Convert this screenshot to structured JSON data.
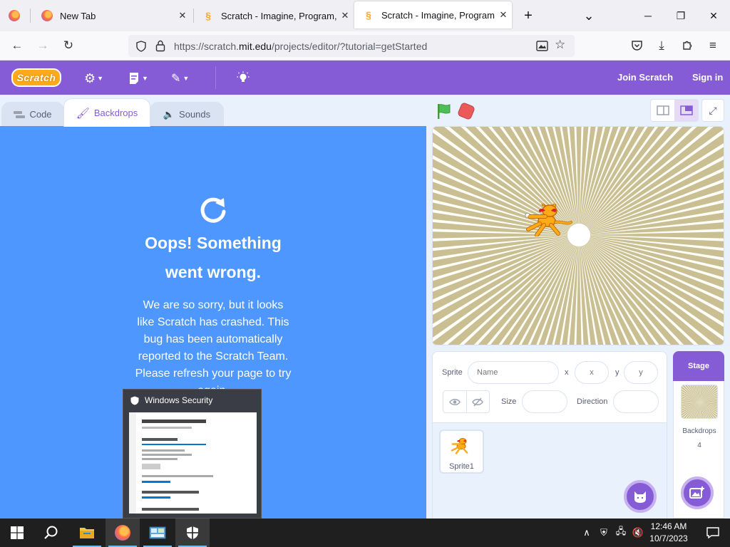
{
  "browser": {
    "tabs": [
      {
        "title": "New Tab",
        "favicon": "firefox-icon"
      },
      {
        "title": "Scratch - Imagine, Program, Sh",
        "favicon": "scratch-icon"
      },
      {
        "title": "Scratch - Imagine, Program, Sh",
        "favicon": "scratch-icon",
        "active": true
      }
    ],
    "new_tab_symbol": "+",
    "tab_list_symbol": "⌄",
    "window_controls": {
      "minimize": "─",
      "restore": "❐",
      "close": "✕"
    },
    "url": {
      "prefix": "https://scratch.",
      "host": "mit.edu",
      "path": "/projects/editor/?tutorial=getStarted"
    }
  },
  "scratch": {
    "logo_text": "Scratch",
    "menu": {
      "join": "Join Scratch",
      "sign_in": "Sign in"
    },
    "editor_tabs": {
      "code": "Code",
      "backdrops": "Backdrops",
      "sounds": "Sounds"
    },
    "error": {
      "title": "Oops! Something went wrong.",
      "body": "We are so sorry, but it looks like Scratch has crashed. This bug has been automatically reported to the Scratch Team. Please refresh your page to try again."
    },
    "sprite_info": {
      "sprite_label": "Sprite",
      "name_placeholder": "Name",
      "x_label": "x",
      "x_placeholder": "x",
      "y_label": "y",
      "y_placeholder": "y",
      "size_label": "Size",
      "direction_label": "Direction"
    },
    "sprites": [
      {
        "name": "Sprite1"
      }
    ],
    "stage_pane": {
      "title": "Stage",
      "backdrops_label": "Backdrops",
      "backdrops_count": "4"
    }
  },
  "popup": {
    "title": "Windows Security"
  },
  "taskbar": {
    "time": "12:46 AM",
    "date": "10/7/2023"
  },
  "colors": {
    "scratch_purple": "#855cd6",
    "error_blue": "#4d97ff",
    "editor_bg": "#e9f1fc",
    "taskbar": "#1f1f1f"
  }
}
